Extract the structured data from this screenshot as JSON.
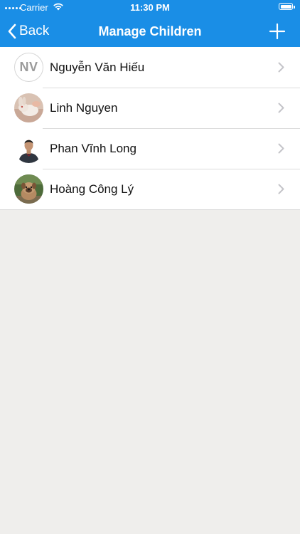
{
  "status_bar": {
    "carrier": "Carrier",
    "time": "11:30 PM"
  },
  "nav": {
    "back_label": "Back",
    "title": "Manage Children"
  },
  "colors": {
    "header": "#1a8ee6",
    "background": "#efeeec"
  },
  "children": [
    {
      "name": "Nguyễn Văn Hiếu",
      "initials": "NV",
      "avatar": "initials"
    },
    {
      "name": "Linh Nguyen",
      "avatar": "rabbit-photo"
    },
    {
      "name": "Phan Vĩnh Long",
      "avatar": "person-photo"
    },
    {
      "name": "Hoàng Công Lý",
      "avatar": "puppy-photo"
    }
  ]
}
